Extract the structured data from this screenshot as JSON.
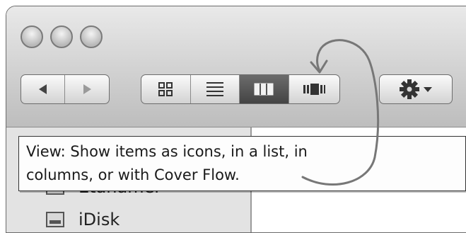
{
  "tooltip": {
    "line1": "View: Show items as icons, in a list, in",
    "line2": "columns, or with Cover Flow."
  },
  "sidebar": {
    "items": [
      {
        "label": "Etanamer",
        "icon": "home-folder-icon"
      },
      {
        "label": "iDisk",
        "icon": "disk-icon"
      }
    ]
  },
  "toolbar": {
    "view_modes": [
      "icon",
      "list",
      "column",
      "cover-flow"
    ],
    "active_view": "column",
    "action_menu_icon": "gear-icon"
  },
  "colors": {
    "toolbar_top": "#e9e9e9",
    "toolbar_bottom": "#bdbdbd",
    "active_segment": "#555555",
    "sidebar": "#e3e3e3"
  }
}
